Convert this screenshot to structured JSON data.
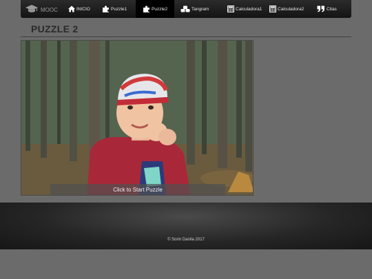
{
  "brand": {
    "label": "MOOC",
    "icon": "graduation-cap-icon"
  },
  "nav": {
    "items": [
      {
        "label": "INICIO",
        "icon": "home-icon"
      },
      {
        "label": "Puzzle1",
        "icon": "puzzle-icon"
      },
      {
        "label": "Puzzle2",
        "icon": "puzzle-icon",
        "active": true
      },
      {
        "label": "Tangram",
        "icon": "cubes-icon"
      },
      {
        "label": "Calculadora1",
        "icon": "calculator-icon"
      },
      {
        "label": "Calculadora2",
        "icon": "calculator-icon"
      },
      {
        "label": "Citas",
        "icon": "quote-icon"
      }
    ]
  },
  "page": {
    "title": "PUZZLE 2"
  },
  "puzzle": {
    "start_label": "Click to Start Puzzle"
  },
  "footer": {
    "copyright": "© Sorin Danila 2017"
  },
  "colors": {
    "navbar": "#1c1c1c",
    "page_bg": "#6b6b6b",
    "footer": "#222222"
  }
}
